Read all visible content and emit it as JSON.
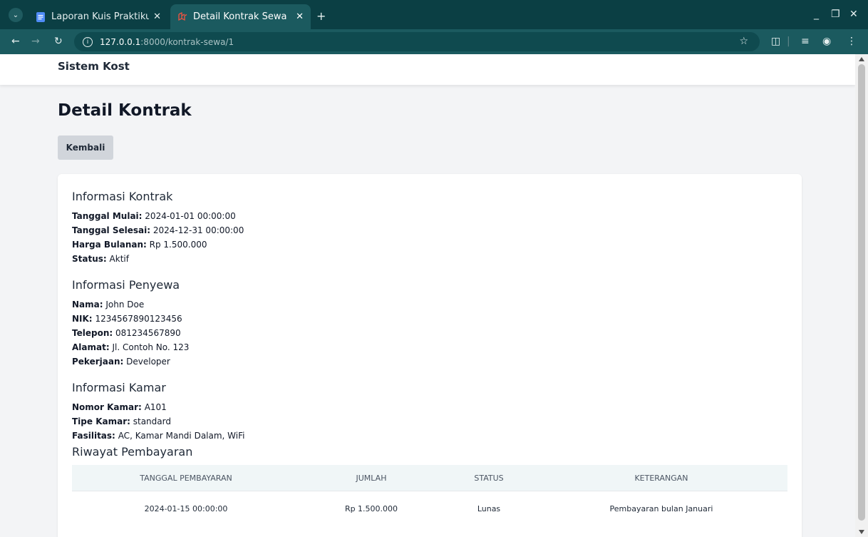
{
  "browser": {
    "tabs": [
      {
        "label": "Laporan Kuis Praktikum I",
        "active": false
      },
      {
        "label": "Detail Kontrak Sewa",
        "active": true
      }
    ],
    "url_host": "127.0.0.1",
    "url_path": ":8000/kontrak-sewa/1"
  },
  "navbar": {
    "brand": "Sistem Kost"
  },
  "page": {
    "title": "Detail Kontrak",
    "back_label": "Kembali"
  },
  "kontrak": {
    "heading": "Informasi Kontrak",
    "fields": [
      {
        "label": "Tanggal Mulai:",
        "value": "2024-01-01 00:00:00"
      },
      {
        "label": "Tanggal Selesai:",
        "value": "2024-12-31 00:00:00"
      },
      {
        "label": "Harga Bulanan:",
        "value": "Rp 1.500.000"
      },
      {
        "label": "Status:",
        "value": "Aktif"
      }
    ]
  },
  "penyewa": {
    "heading": "Informasi Penyewa",
    "fields": [
      {
        "label": "Nama:",
        "value": "John Doe"
      },
      {
        "label": "NIK:",
        "value": "1234567890123456"
      },
      {
        "label": "Telepon:",
        "value": "081234567890"
      },
      {
        "label": "Alamat:",
        "value": "Jl. Contoh No. 123"
      },
      {
        "label": "Pekerjaan:",
        "value": "Developer"
      }
    ]
  },
  "kamar": {
    "heading": "Informasi Kamar",
    "fields": [
      {
        "label": "Nomor Kamar:",
        "value": "A101"
      },
      {
        "label": "Tipe Kamar:",
        "value": "standard"
      },
      {
        "label": "Fasilitas:",
        "value": "AC, Kamar Mandi Dalam, WiFi"
      }
    ]
  },
  "pembayaran": {
    "heading": "Riwayat Pembayaran",
    "columns": [
      "TANGGAL PEMBAYARAN",
      "JUMLAH",
      "STATUS",
      "KETERANGAN"
    ],
    "rows": [
      [
        "2024-01-15 00:00:00",
        "Rp 1.500.000",
        "Lunas",
        "Pembayaran bulan Januari"
      ]
    ]
  }
}
